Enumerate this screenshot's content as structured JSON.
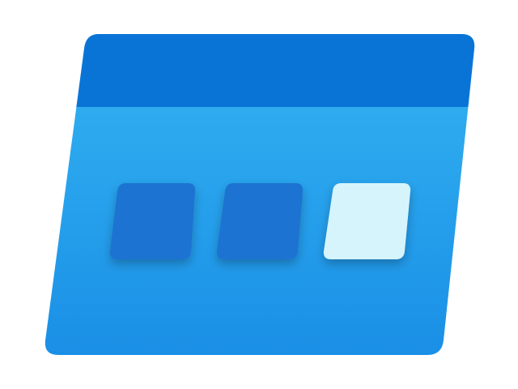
{
  "logo": {
    "icon_name": "storage-explorer-icon",
    "colors": {
      "header": "#0A74D6",
      "body_top": "#34B4F2",
      "body_bottom": "#1A8FE6",
      "tile_dark": "#1D73D2",
      "tile_light": "#D6F4FB"
    }
  }
}
